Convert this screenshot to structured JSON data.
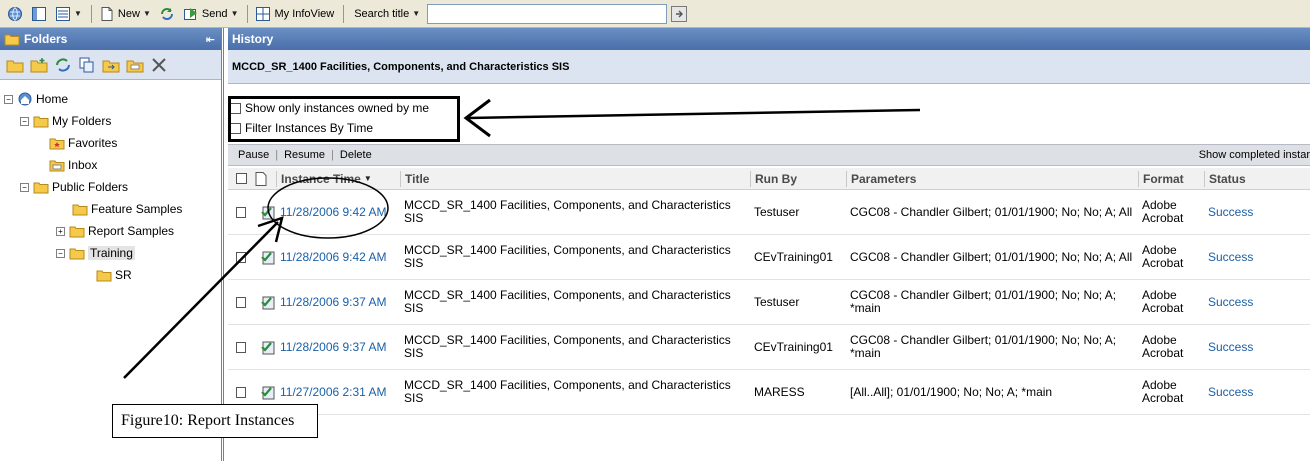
{
  "toolbar": {
    "new_label": "New",
    "send_label": "Send",
    "infoview_label": "My InfoView",
    "search_mode_label": "Search title",
    "search_value": ""
  },
  "folders": {
    "title": "Folders",
    "tree": [
      {
        "label": "Home",
        "icon": "home-icon"
      },
      {
        "label": "My Folders",
        "icon": "folder-icon"
      },
      {
        "label": "Favorites",
        "icon": "favorites-folder-icon"
      },
      {
        "label": "Inbox",
        "icon": "inbox-folder-icon"
      },
      {
        "label": "Public Folders",
        "icon": "folder-icon"
      },
      {
        "label": "Feature Samples",
        "icon": "folder-icon"
      },
      {
        "label": "Report Samples",
        "icon": "folder-icon"
      },
      {
        "label": "Training",
        "icon": "folder-icon"
      },
      {
        "label": "SR",
        "icon": "folder-icon"
      }
    ]
  },
  "history": {
    "title": "History",
    "report_title": "MCCD_SR_1400 Facilities, Components, and Characteristics SIS",
    "options": {
      "owned_by_me": "Show only instances owned by me",
      "filter_by_time": "Filter Instances By Time"
    },
    "actions": {
      "pause": "Pause",
      "resume": "Resume",
      "delete": "Delete",
      "show_completed": "Show completed instar"
    },
    "columns": {
      "instance_time": "Instance Time",
      "title": "Title",
      "run_by": "Run By",
      "parameters": "Parameters",
      "format": "Format",
      "status": "Status"
    },
    "rows": [
      {
        "time": "11/28/2006 9:42 AM",
        "title": "MCCD_SR_1400 Facilities, Components, and Characteristics SIS",
        "run_by": "Testuser",
        "parameters": "CGC08 - Chandler Gilbert; 01/01/1900; No; No; A; All",
        "format": "Adobe Acrobat",
        "status": "Success"
      },
      {
        "time": "11/28/2006 9:42 AM",
        "title": "MCCD_SR_1400 Facilities, Components, and Characteristics SIS",
        "run_by": "CEvTraining01",
        "parameters": "CGC08 - Chandler Gilbert; 01/01/1900; No; No; A; All",
        "format": "Adobe Acrobat",
        "status": "Success"
      },
      {
        "time": "11/28/2006 9:37 AM",
        "title": "MCCD_SR_1400 Facilities, Components, and Characteristics SIS",
        "run_by": "Testuser",
        "parameters": "CGC08 - Chandler Gilbert; 01/01/1900; No; No; A; *main",
        "format": "Adobe Acrobat",
        "status": "Success"
      },
      {
        "time": "11/28/2006 9:37 AM",
        "title": "MCCD_SR_1400 Facilities, Components, and Characteristics SIS",
        "run_by": "CEvTraining01",
        "parameters": "CGC08 - Chandler Gilbert; 01/01/1900; No; No; A; *main",
        "format": "Adobe Acrobat",
        "status": "Success"
      },
      {
        "time": "11/27/2006 2:31 AM",
        "title": "MCCD_SR_1400 Facilities, Components, and Characteristics SIS",
        "run_by": "MARESS",
        "parameters": "[All..All]; 01/01/1900; No; No; A; *main",
        "format": "Adobe Acrobat",
        "status": "Success"
      }
    ]
  },
  "caption": "Figure10: Report Instances",
  "colors": {
    "header_blue": "#4a6fa9",
    "link_blue": "#1a60a8",
    "toolbar_bg": "#ece9d8"
  }
}
